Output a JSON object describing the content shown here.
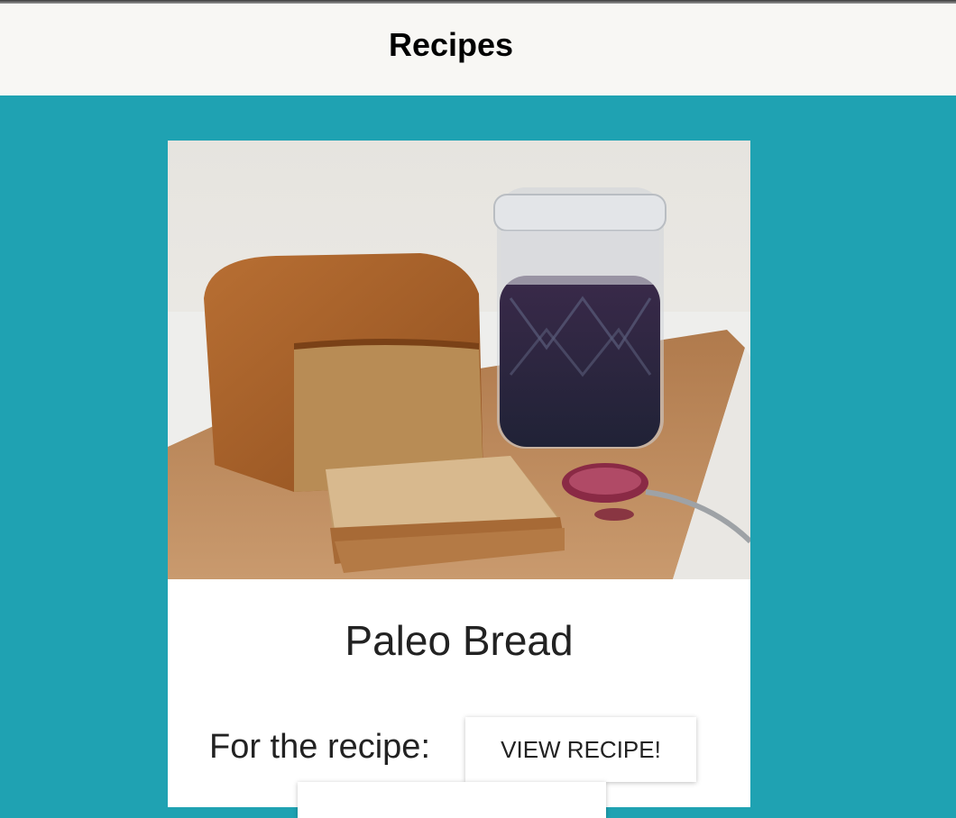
{
  "header": {
    "title": "Recipes"
  },
  "card": {
    "image_alt": "Paleo bread loaf with jar of jam and spoon",
    "title": "Paleo Bread",
    "recipe_label": "For the recipe:",
    "view_button_label": "VIEW RECIPE!"
  }
}
